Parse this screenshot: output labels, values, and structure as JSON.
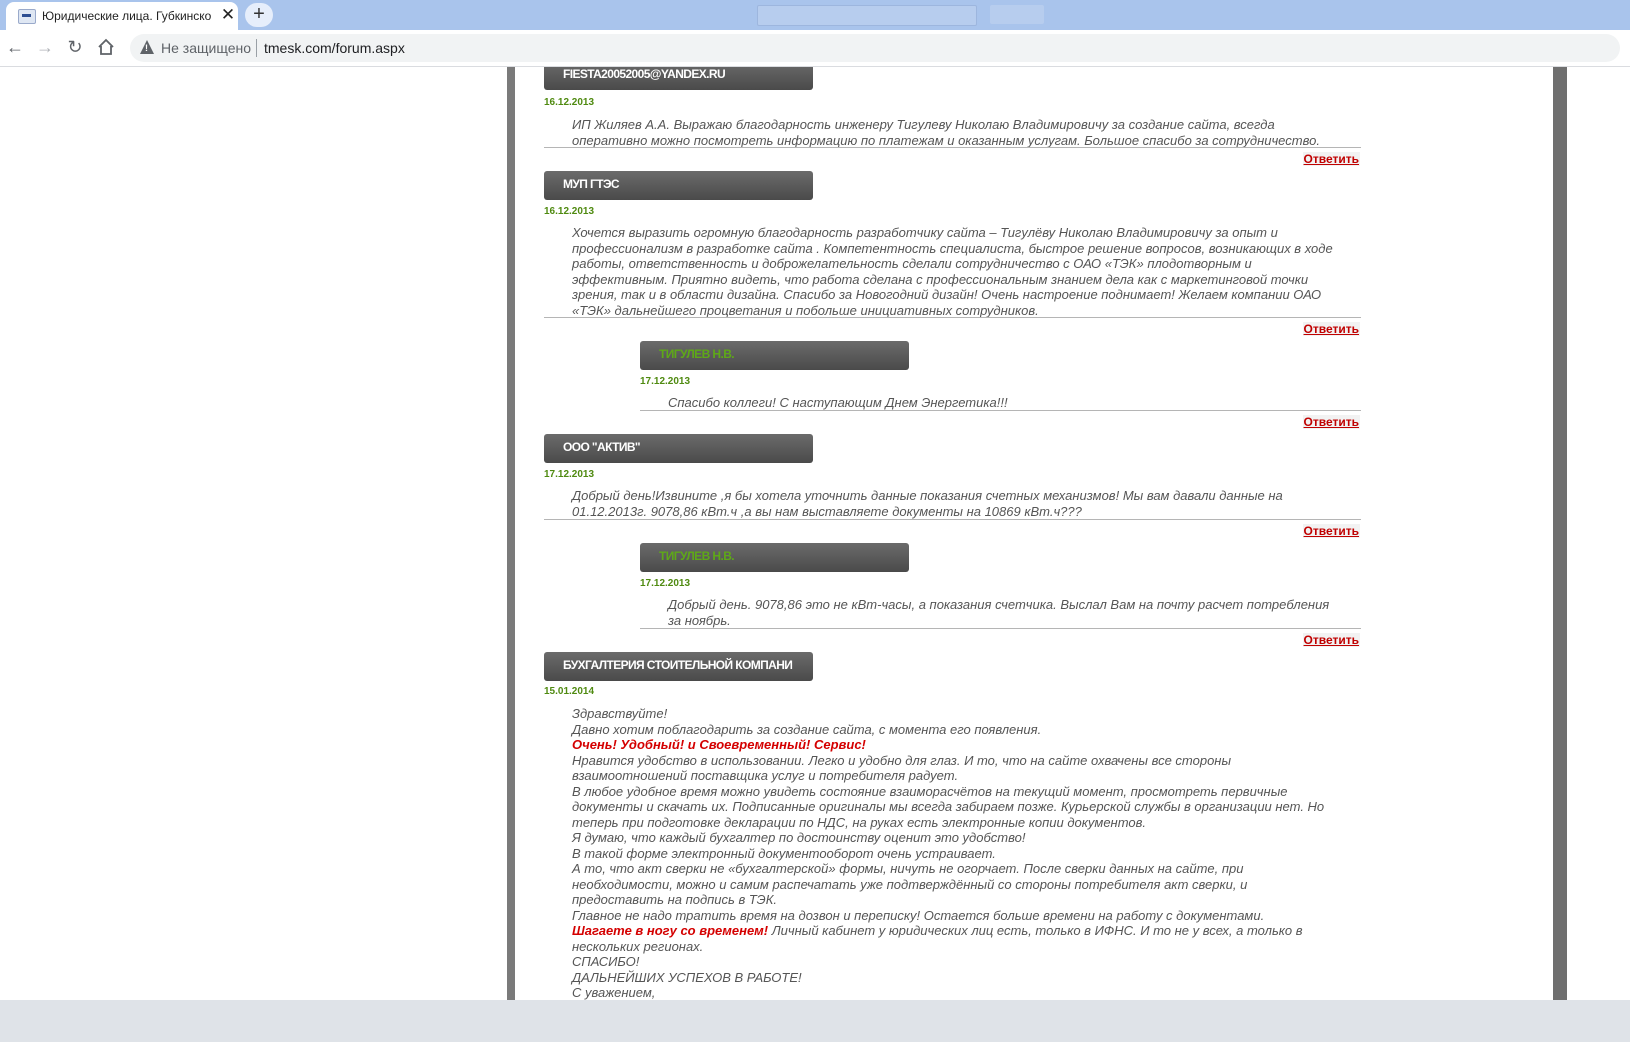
{
  "browser": {
    "tab_title": "Юридические лица. Губкинско",
    "tab_close": "✕",
    "new_tab": "+",
    "not_secure": "Не защищено",
    "url": "tmesk.com/forum.aspx"
  },
  "forum": {
    "answer_label": "Ответить",
    "posts": [
      {
        "author": "FIESTA20052005@YANDEX.RU",
        "date": "16.12.2013",
        "text": "ИП Жиляев А.А. Выражаю благодарность инженеру Тигулеву Николаю Владимировичу за создание сайта, всегда\nоперативно можно посмотреть информацию по платежам и оказанным услугам. Большое спасибо за сотрудничество."
      },
      {
        "author": "МУП ГТЭС",
        "date": "16.12.2013",
        "text": "Хочется выразить огромную благодарность разработчику сайта – Тигулёву Николаю Владимировичу за опыт и\nпрофессионализм в разработке сайта . Компетентность специалиста, быстрое решение вопросов, возникающих в ходе\nработы, ответственность и доброжелательность сделали сотрудничество с ОАО «ТЭК» плодотворным и\nэффективным. Приятно видеть, что работа сделана с профессиональным знанием дела как с маркетинговой точки\nзрения, так и в области дизайна. Спасибо за Новогодний дизайн! Очень настроение поднимает! Желаем компании ОАО\n«ТЭК» дальнейшего процветания и побольше инициативных сотрудников."
      },
      {
        "author": "ТИГУЛЕВ Н.В.",
        "date": "17.12.2013",
        "text": "Спасибо коллеги! С наступающим Днем Энергетика!!!"
      },
      {
        "author": "ООО \"АКТИВ\"",
        "date": "17.12.2013",
        "text": "Добрый день!Извините ,я бы хотела уточнить данные показания счетных механизмов! Мы вам давали данные на\n01.12.2013г. 9078,86 кВт.ч ,а вы нам выставляете документы на 10869 кВт.ч???"
      },
      {
        "author": "ТИГУЛЕВ Н.В.",
        "date": "17.12.2013",
        "text": "Добрый день. 9078,86 это не кВт-часы, а показания счетчика. Выслал Вам на почту расчет потребления\nза ноябрь."
      },
      {
        "author": "БУХГАЛТЕРИЯ СТОИТЕЛЬНОЙ КОМПАНИ",
        "date": "15.01.2014",
        "lines": {
          "l1": "Здравствуйте!",
          "l2": "Давно хотим поблагодарить за создание сайта, с момента его появления.",
          "l3": "Очень! Удобный! и Своевременный! Сервис!",
          "l4": "Нравится удобство в использовании. Легко и удобно для глаз. И то, что на сайте охвачены все стороны\nвзаимоотношений поставщика услуг и потребителя радует.",
          "l5": "В любое удобное время можно увидеть состояние взаиморасчётов на текущий момент, просмотреть первичные\nдокументы и скачать их. Подписанные оригиналы мы всегда забираем позже. Курьерской службы в организации нет. Но\nтеперь при подготовке декларации по НДС, на руках есть электронные копии документов.",
          "l6": "Я думаю, что каждый бухгалтер по достоинству оценит это удобство!",
          "l7": "В такой форме электронный документооборот очень устраивает.",
          "l8": "А то, что акт сверки не «бухгалтерской» формы, ничуть не огорчает. После сверки данных на сайте, при\nнеобходимости, можно и самим распечатать уже подтверждённый со стороны потребителя акт сверки, и\nпредоставить на подпись в ТЭК.",
          "l9": "Главное не надо тратить время на дозвон и переписку! Остается больше времени на работу с документами.",
          "l10a": "Шагаете в ногу со временем!",
          "l10b": " Личный кабинет у юридических лиц есть, только в ИФНС. И то не у всех, а только в\nнескольких регионах.",
          "l11": "СПАСИБО!",
          "l12": "ДАЛЬНЕЙШИХ УСПЕХОВ В РАБОТЕ!",
          "l13": "С уважением,"
        }
      }
    ]
  }
}
